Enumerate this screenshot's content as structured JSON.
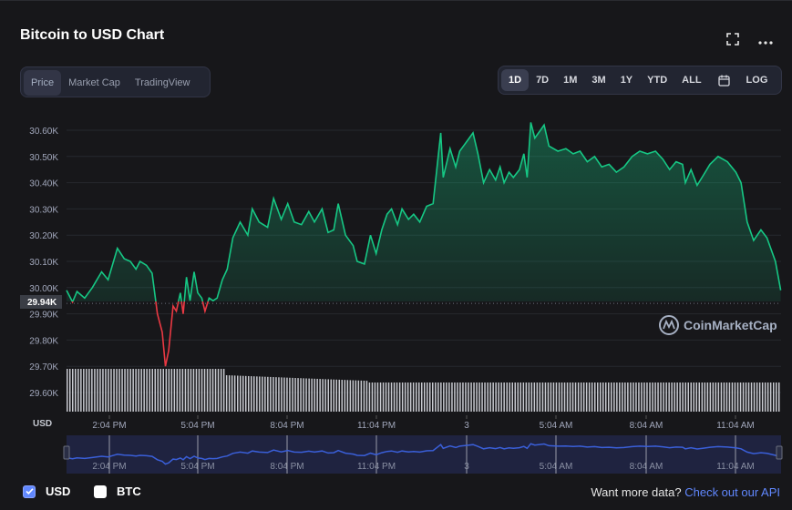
{
  "title": "Bitcoin to USD Chart",
  "header_icons": [
    "fullscreen-icon",
    "more-options-icon"
  ],
  "view_tabs": [
    {
      "label": "Price",
      "active": true
    },
    {
      "label": "Market Cap",
      "active": false
    },
    {
      "label": "TradingView",
      "active": false
    }
  ],
  "range_tabs": [
    {
      "label": "1D",
      "active": true
    },
    {
      "label": "7D",
      "active": false
    },
    {
      "label": "1M",
      "active": false
    },
    {
      "label": "3M",
      "active": false
    },
    {
      "label": "1Y",
      "active": false
    },
    {
      "label": "YTD",
      "active": false
    },
    {
      "label": "ALL",
      "active": false
    }
  ],
  "calendar_icon": "calendar-icon",
  "log_label": "LOG",
  "watermark": "CoinMarketCap",
  "current_price_label": "29.94K",
  "currency_label": "USD",
  "colors": {
    "up": "#16c784",
    "down": "#ea3943",
    "accent": "#6188ff",
    "background": "#17171a"
  },
  "chart_data": {
    "type": "area",
    "y_tick_labels": [
      "30.60K",
      "30.50K",
      "30.40K",
      "30.30K",
      "30.20K",
      "30.10K",
      "30.00K",
      "29.90K",
      "29.80K",
      "29.70K",
      "29.60K"
    ],
    "ylim": [
      29600,
      30600
    ],
    "x_tick_labels": [
      "2:04 PM",
      "5:04 PM",
      "8:04 PM",
      "11:04 PM",
      "3",
      "5:04 AM",
      "8:04 AM",
      "11:04 AM"
    ],
    "baseline": 29940,
    "points": [
      [
        0,
        29990
      ],
      [
        1.5,
        29945
      ],
      [
        2.6,
        29985
      ],
      [
        4.5,
        29960
      ],
      [
        6.4,
        30000
      ],
      [
        8.7,
        30060
      ],
      [
        10.3,
        30030
      ],
      [
        12.6,
        30150
      ],
      [
        14.3,
        30110
      ],
      [
        15.8,
        30100
      ],
      [
        17.2,
        30070
      ],
      [
        18.2,
        30100
      ],
      [
        19.8,
        30085
      ],
      [
        21.2,
        30055
      ],
      [
        22.5,
        29900
      ],
      [
        23.7,
        29830
      ],
      [
        24.5,
        29700
      ],
      [
        25.3,
        29760
      ],
      [
        26.4,
        29930
      ],
      [
        27.2,
        29910
      ],
      [
        28.2,
        29980
      ],
      [
        28.9,
        29900
      ],
      [
        29.7,
        30040
      ],
      [
        30.6,
        29950
      ],
      [
        31.6,
        30060
      ],
      [
        32.5,
        29980
      ],
      [
        33.5,
        29960
      ],
      [
        34.3,
        29910
      ],
      [
        35.3,
        29960
      ],
      [
        36.3,
        29950
      ],
      [
        37.3,
        29960
      ],
      [
        38.6,
        30030
      ],
      [
        39.8,
        30070
      ],
      [
        41.2,
        30190
      ],
      [
        43.0,
        30250
      ],
      [
        44.9,
        30200
      ],
      [
        46.0,
        30300
      ],
      [
        47.7,
        30250
      ],
      [
        49.8,
        30230
      ],
      [
        51.3,
        30340
      ],
      [
        53.2,
        30260
      ],
      [
        54.8,
        30320
      ],
      [
        56.4,
        30250
      ],
      [
        58.2,
        30240
      ],
      [
        60.0,
        30290
      ],
      [
        61.4,
        30250
      ],
      [
        63.3,
        30300
      ],
      [
        64.8,
        30210
      ],
      [
        66.2,
        30220
      ],
      [
        67.3,
        30320
      ],
      [
        69.1,
        30200
      ],
      [
        71.0,
        30160
      ],
      [
        72.0,
        30100
      ],
      [
        73.8,
        30090
      ],
      [
        75.3,
        30200
      ],
      [
        76.7,
        30130
      ],
      [
        78.1,
        30220
      ],
      [
        79.4,
        30280
      ],
      [
        80.5,
        30300
      ],
      [
        82.0,
        30240
      ],
      [
        83.1,
        30300
      ],
      [
        84.7,
        30260
      ],
      [
        86.0,
        30280
      ],
      [
        87.5,
        30250
      ],
      [
        89.2,
        30310
      ],
      [
        90.8,
        30320
      ],
      [
        92.7,
        30590
      ],
      [
        93.3,
        30420
      ],
      [
        95.0,
        30530
      ],
      [
        96.4,
        30460
      ],
      [
        97.4,
        30520
      ],
      [
        99.3,
        30560
      ],
      [
        100.7,
        30590
      ],
      [
        101.9,
        30510
      ],
      [
        103.3,
        30400
      ],
      [
        104.8,
        30450
      ],
      [
        106.3,
        30410
      ],
      [
        107.4,
        30460
      ],
      [
        108.4,
        30400
      ],
      [
        109.6,
        30440
      ],
      [
        110.7,
        30420
      ],
      [
        112.2,
        30450
      ],
      [
        113.3,
        30510
      ],
      [
        114.1,
        30420
      ],
      [
        115.0,
        30630
      ],
      [
        116.0,
        30570
      ],
      [
        117.4,
        30600
      ],
      [
        118.3,
        30620
      ],
      [
        119.5,
        30540
      ],
      [
        121.7,
        30520
      ],
      [
        123.7,
        30530
      ],
      [
        125.5,
        30510
      ],
      [
        127.2,
        30520
      ],
      [
        129.0,
        30480
      ],
      [
        130.8,
        30500
      ],
      [
        132.6,
        30460
      ],
      [
        134.4,
        30470
      ],
      [
        136.2,
        30440
      ],
      [
        138.1,
        30460
      ],
      [
        140.1,
        30500
      ],
      [
        142.0,
        30520
      ],
      [
        143.9,
        30510
      ],
      [
        145.9,
        30520
      ],
      [
        147.7,
        30490
      ],
      [
        149.4,
        30450
      ],
      [
        151.0,
        30480
      ],
      [
        152.6,
        30470
      ],
      [
        153.3,
        30400
      ],
      [
        154.7,
        30450
      ],
      [
        156.2,
        30390
      ],
      [
        157.8,
        30430
      ],
      [
        159.4,
        30470
      ],
      [
        161.4,
        30500
      ],
      [
        163.7,
        30480
      ],
      [
        165.8,
        30440
      ],
      [
        167.1,
        30400
      ],
      [
        168.6,
        30250
      ],
      [
        170.2,
        30180
      ],
      [
        172.0,
        30220
      ],
      [
        173.5,
        30190
      ],
      [
        175.6,
        30100
      ],
      [
        176.9,
        29990
      ]
    ],
    "xlim": [
      0,
      177
    ]
  },
  "legend": [
    {
      "label": "USD",
      "checked": true
    },
    {
      "label": "BTC",
      "checked": false
    }
  ],
  "api_text": "Want more data?",
  "api_link": "Check out our API"
}
